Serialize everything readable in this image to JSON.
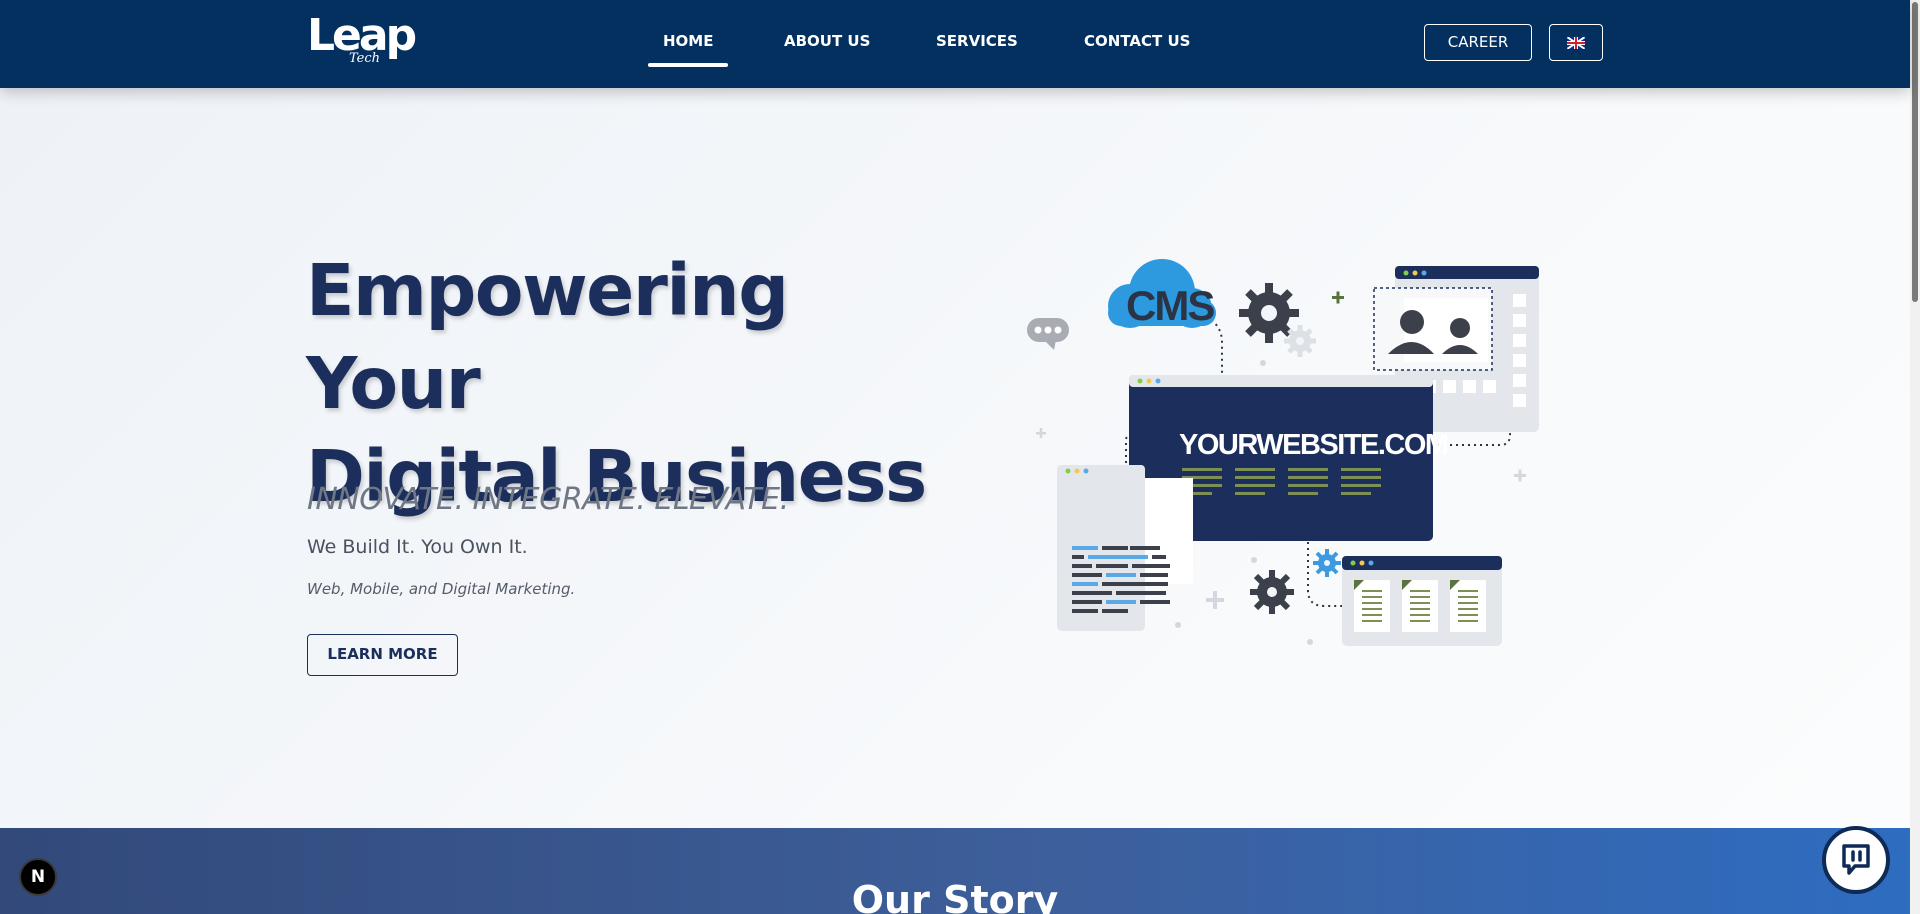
{
  "header": {
    "logo": {
      "main": "Leap",
      "sub": "Tech"
    },
    "nav": [
      {
        "label": "HOME",
        "active": true
      },
      {
        "label": "ABOUT US",
        "active": false
      },
      {
        "label": "SERVICES",
        "active": false
      },
      {
        "label": "CONTACT US",
        "active": false
      }
    ],
    "career_label": "CAREER",
    "language_icon": "uk-flag-icon"
  },
  "hero": {
    "title_line1": "Empowering Your",
    "title_line2": "Digital Business",
    "tagline": "INNOVATE. INTEGRATE. ELEVATE.",
    "subtitle": "We Build It. You Own It.",
    "note": "Web, Mobile, and Digital Marketing.",
    "cta_label": "LEARN MORE",
    "illustration": {
      "cms_label": "CMS",
      "website_label": "YOURWEBSITE.COM"
    }
  },
  "story": {
    "title": "Our Story"
  },
  "floating": {
    "next_badge": "N",
    "chat_icon": "chat-bubble-icon"
  },
  "colors": {
    "navbar": "#03305f",
    "heading": "#1c2f5c",
    "story_start": "#32497a",
    "story_end": "#2e6cc0"
  }
}
